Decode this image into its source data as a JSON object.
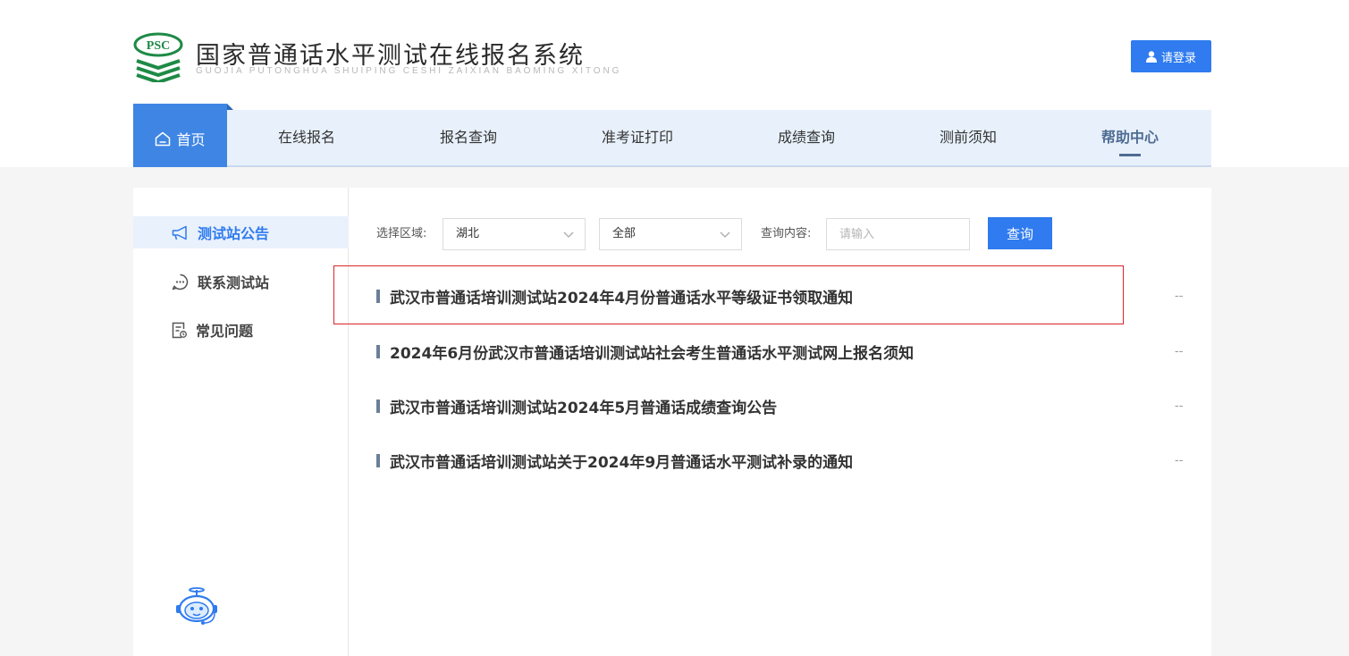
{
  "header": {
    "logo_text": "PSC",
    "title": "国家普通话水平测试在线报名系统",
    "subtitle": "GUOJIA PUTONGHUA SHUIPING CESHI ZAIXIAN BAOMING XITONG",
    "login_label": "请登录"
  },
  "nav": {
    "home": "首页",
    "items": [
      "在线报名",
      "报名查询",
      "准考证打印",
      "成绩查询",
      "测前须知",
      "帮助中心"
    ]
  },
  "sidebar": {
    "items": [
      {
        "label": "测试站公告",
        "icon": "megaphone-icon"
      },
      {
        "label": "联系测试站",
        "icon": "chat-icon"
      },
      {
        "label": "常见问题",
        "icon": "document-clock-icon"
      }
    ]
  },
  "filter": {
    "region_label": "选择区域:",
    "region_value": "湖北",
    "sub_value": "全部",
    "query_label": "查询内容:",
    "query_placeholder": "请输入",
    "query_button": "查询"
  },
  "news": [
    {
      "title": "武汉市普通话培训测试站2024年4月份普通话水平等级证书领取通知",
      "date": "--"
    },
    {
      "title": "2024年6月份武汉市普通话培训测试站社会考生普通话水平测试网上报名须知",
      "date": "--"
    },
    {
      "title": "武汉市普通话培训测试站2024年5月普通话成绩查询公告",
      "date": "--"
    },
    {
      "title": "武汉市普通话培训测试站关于2024年9月普通话水平测试补录的通知",
      "date": "--"
    }
  ],
  "colors": {
    "accent": "#2f7bef",
    "nav_bg": "#e8f1fb",
    "highlight_border": "#d9252a",
    "logo_green": "#1e8a46"
  }
}
